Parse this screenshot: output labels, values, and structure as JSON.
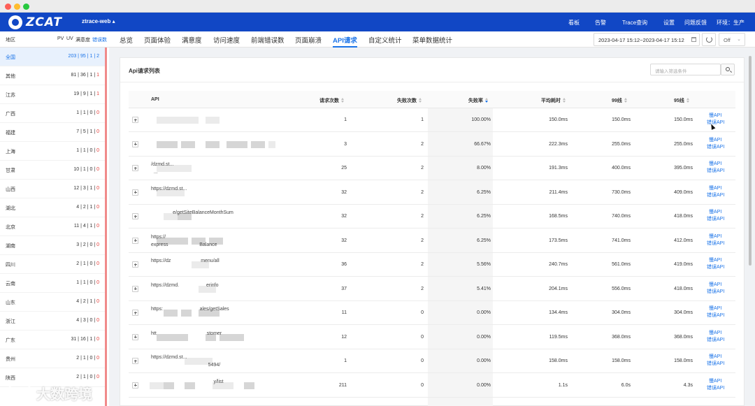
{
  "topnav": {
    "logo_text": "ZCAT",
    "app_name": "ztrace-web ▴",
    "items": [
      "看板",
      "告警",
      "Trace查询",
      "设置",
      "问题反馈",
      "环境：生产"
    ]
  },
  "tabbar": {
    "region_label": "地区",
    "metric_tabs": [
      "PV",
      "UV",
      "满意度",
      "错误数"
    ],
    "main_tabs": [
      "总览",
      "页面体验",
      "满意度",
      "访问速度",
      "前端错误数",
      "页面崩溃",
      "API请求",
      "自定义统计",
      "菜单数据统计"
    ],
    "active_tab": "API请求",
    "date_range": "2023-04-17 15:12~2023-04-17 15:12",
    "refresh_select": "Off"
  },
  "regions": [
    {
      "name": "全国",
      "a": "203",
      "b": "95",
      "c": "1",
      "d": "2",
      "active": true
    },
    {
      "name": "其他",
      "a": "81",
      "b": "36",
      "c": "1",
      "d": "1"
    },
    {
      "name": "江苏",
      "a": "19",
      "b": "9",
      "c": "1",
      "d": "1"
    },
    {
      "name": "广西",
      "a": "1",
      "b": "1",
      "c": "0",
      "d": "0"
    },
    {
      "name": "福建",
      "a": "7",
      "b": "5",
      "c": "1",
      "d": "0"
    },
    {
      "name": "上海",
      "a": "1",
      "b": "1",
      "c": "0",
      "d": "0"
    },
    {
      "name": "甘肃",
      "a": "10",
      "b": "1",
      "c": "0",
      "d": "0"
    },
    {
      "name": "山西",
      "a": "12",
      "b": "3",
      "c": "1",
      "d": "0"
    },
    {
      "name": "湖北",
      "a": "4",
      "b": "2",
      "c": "1",
      "d": "0"
    },
    {
      "name": "北京",
      "a": "11",
      "b": "4",
      "c": "1",
      "d": "0"
    },
    {
      "name": "湖南",
      "a": "3",
      "b": "2",
      "c": "0",
      "d": "0"
    },
    {
      "name": "四川",
      "a": "2",
      "b": "1",
      "c": "0",
      "d": "0"
    },
    {
      "name": "云南",
      "a": "1",
      "b": "1",
      "c": "0",
      "d": "0"
    },
    {
      "name": "山东",
      "a": "4",
      "b": "2",
      "c": "1",
      "d": "0"
    },
    {
      "name": "浙江",
      "a": "4",
      "b": "3",
      "c": "0",
      "d": "0"
    },
    {
      "name": "广东",
      "a": "31",
      "b": "16",
      "c": "1",
      "d": "0"
    },
    {
      "name": "贵州",
      "a": "2",
      "b": "1",
      "c": "0",
      "d": "0"
    },
    {
      "name": "陕西",
      "a": "2",
      "b": "1",
      "c": "0",
      "d": "0"
    }
  ],
  "panel": {
    "title": "Api请求列表",
    "search_placeholder": "请输入筛选条件",
    "columns": [
      "API",
      "请求次数",
      "失败次数",
      "失败率",
      "平均耗时",
      "99线",
      "95线"
    ],
    "rows": [
      {
        "api": "",
        "req": "1",
        "fail": "1",
        "rate": "100.00%",
        "avg": "150.0ms",
        "p99": "150.0ms",
        "p95": "150.0ms"
      },
      {
        "api": "",
        "req": "3",
        "fail": "2",
        "rate": "66.67%",
        "avg": "222.3ms",
        "p99": "255.0ms",
        "p95": "255.0ms"
      },
      {
        "api": "/dzmd.st...\n  ...",
        "req": "25",
        "fail": "2",
        "rate": "8.00%",
        "avg": "191.3ms",
        "p99": "400.0ms",
        "p95": "395.0ms"
      },
      {
        "api": "https://dzmd.st...",
        "req": "32",
        "fail": "2",
        "rate": "6.25%",
        "avg": "211.4ms",
        "p99": "730.0ms",
        "p95": "409.0ms"
      },
      {
        "api": "                e/getSiteBalanceMonthSum",
        "req": "32",
        "fail": "2",
        "rate": "6.25%",
        "avg": "168.5ms",
        "p99": "740.0ms",
        "p95": "418.0ms"
      },
      {
        "api": "https://\nexpress                       Balance",
        "req": "32",
        "fail": "2",
        "rate": "6.25%",
        "avg": "173.5ms",
        "p99": "741.0ms",
        "p95": "412.0ms"
      },
      {
        "api": "https://dz                      menu/all",
        "req": "36",
        "fail": "2",
        "rate": "5.56%",
        "avg": "240.7ms",
        "p99": "561.0ms",
        "p95": "419.0ms"
      },
      {
        "api": "https://dzmd.                    erinfo",
        "req": "37",
        "fail": "2",
        "rate": "5.41%",
        "avg": "204.1ms",
        "p99": "556.0ms",
        "p95": "418.0ms"
      },
      {
        "api": "https:                           ales/getSales",
        "req": "11",
        "fail": "0",
        "rate": "0.00%",
        "avg": "134.4ms",
        "p99": "304.0ms",
        "p95": "304.0ms"
      },
      {
        "api": "htt                                     stomer",
        "req": "12",
        "fail": "0",
        "rate": "0.00%",
        "avg": "119.5ms",
        "p99": "368.0ms",
        "p95": "368.0ms"
      },
      {
        "api": "https://dzmd.st...\n                                          5494/",
        "req": "1",
        "fail": "0",
        "rate": "0.00%",
        "avg": "158.0ms",
        "p99": "158.0ms",
        "p95": "158.0ms"
      },
      {
        "api": "                                              y/list",
        "req": "211",
        "fail": "0",
        "rate": "0.00%",
        "avg": "1.1s",
        "p99": "6.0s",
        "p95": "4.3s"
      }
    ],
    "link_1": "慢API",
    "link_2": "错误API"
  },
  "watermark": "大数跨境",
  "colors": {
    "nav_bg": "#1147c5",
    "accent": "#1a73e8",
    "error": "#e53935",
    "sidebar_border": "#f08a8a"
  }
}
